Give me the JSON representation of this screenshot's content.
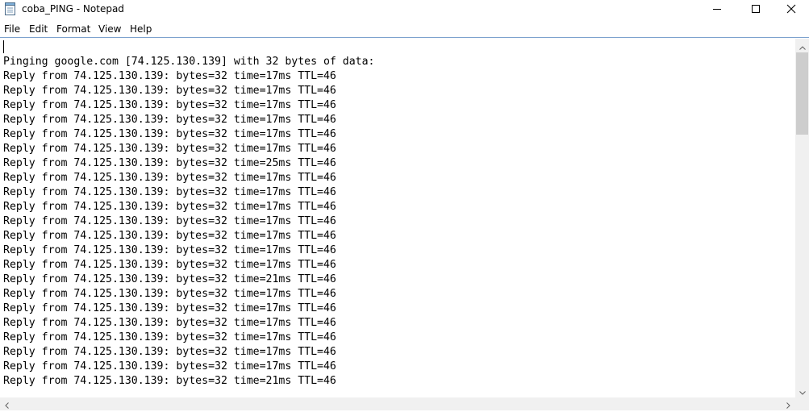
{
  "window": {
    "title": "coba_PING - Notepad",
    "icons": {
      "app": "notepad-icon",
      "minimize": "minimize-icon",
      "maximize": "maximize-icon",
      "close": "close-icon"
    }
  },
  "menu": {
    "items": [
      {
        "label": "File"
      },
      {
        "label": "Edit"
      },
      {
        "label": "Format"
      },
      {
        "label": "View"
      },
      {
        "label": "Help"
      }
    ]
  },
  "editor": {
    "lines": [
      "Pinging google.com [74.125.130.139] with 32 bytes of data:",
      "Reply from 74.125.130.139: bytes=32 time=17ms TTL=46",
      "Reply from 74.125.130.139: bytes=32 time=17ms TTL=46",
      "Reply from 74.125.130.139: bytes=32 time=17ms TTL=46",
      "Reply from 74.125.130.139: bytes=32 time=17ms TTL=46",
      "Reply from 74.125.130.139: bytes=32 time=17ms TTL=46",
      "Reply from 74.125.130.139: bytes=32 time=17ms TTL=46",
      "Reply from 74.125.130.139: bytes=32 time=25ms TTL=46",
      "Reply from 74.125.130.139: bytes=32 time=17ms TTL=46",
      "Reply from 74.125.130.139: bytes=32 time=17ms TTL=46",
      "Reply from 74.125.130.139: bytes=32 time=17ms TTL=46",
      "Reply from 74.125.130.139: bytes=32 time=17ms TTL=46",
      "Reply from 74.125.130.139: bytes=32 time=17ms TTL=46",
      "Reply from 74.125.130.139: bytes=32 time=17ms TTL=46",
      "Reply from 74.125.130.139: bytes=32 time=17ms TTL=46",
      "Reply from 74.125.130.139: bytes=32 time=21ms TTL=46",
      "Reply from 74.125.130.139: bytes=32 time=17ms TTL=46",
      "Reply from 74.125.130.139: bytes=32 time=17ms TTL=46",
      "Reply from 74.125.130.139: bytes=32 time=17ms TTL=46",
      "Reply from 74.125.130.139: bytes=32 time=17ms TTL=46",
      "Reply from 74.125.130.139: bytes=32 time=17ms TTL=46",
      "Reply from 74.125.130.139: bytes=32 time=17ms TTL=46",
      "Reply from 74.125.130.139: bytes=32 time=21ms TTL=46"
    ]
  },
  "colors": {
    "menu_border": "#7da2ce",
    "scrollbar_track": "#f0f0f0",
    "scrollbar_thumb": "#cdcdcd"
  }
}
